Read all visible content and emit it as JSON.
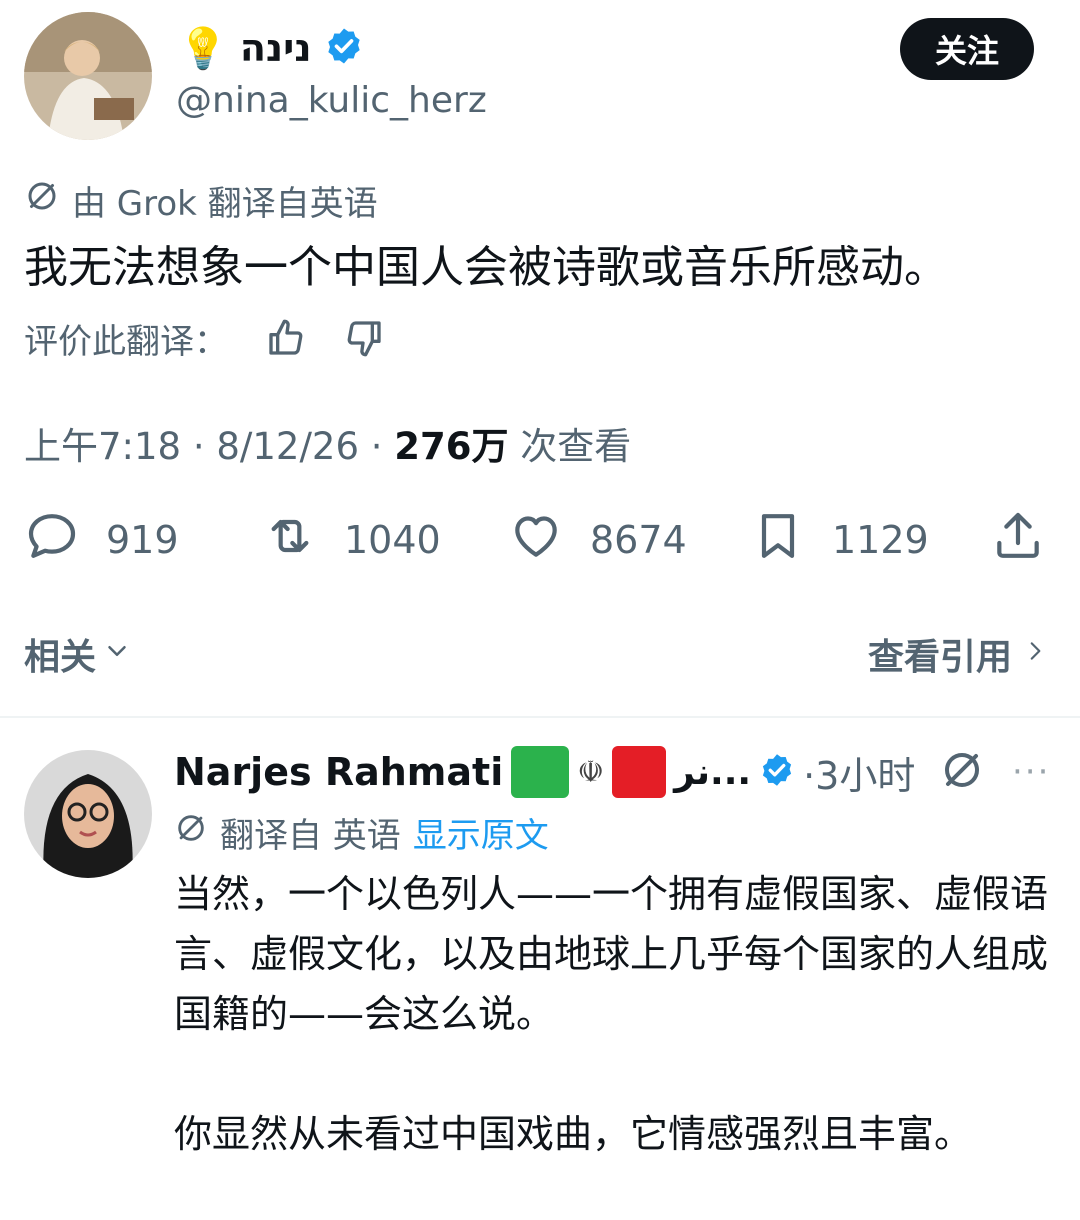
{
  "tweet": {
    "author_prefix_emoji": "💡",
    "author_name": "נינה",
    "handle": "@nina_kulic_herz",
    "follow_label": "关注",
    "translation_note": "由 Grok 翻译自英语",
    "text": "我无法想象一个中国人会被诗歌或音乐所感动。",
    "rate_label": "评价此翻译：",
    "meta_time": "上午7:18 · 8/12/26 · ",
    "meta_views": "276万",
    "meta_views_suffix": " 次查看",
    "stats": {
      "replies": "919",
      "retweets": "1040",
      "likes": "8674",
      "bookmarks": "1129"
    },
    "related_label": "相关",
    "quotes_label": "查看引用"
  },
  "reply": {
    "author_name": "Narjes Rahmati",
    "flag_emblem": "☫",
    "rtl_name": "نر...",
    "time": "·3小时",
    "more_label": "···",
    "translation_note": "翻译自 英语",
    "show_original": "显示原文",
    "paragraphs": [
      "当然，一个以色列人——一个拥有虚假国家、虚假语言、虚假文化，以及由地球上几乎每个国家的人组成国籍的——会这么说。",
      "你显然从未看过中国戏曲，它情感强烈且丰富。"
    ]
  },
  "colors": {
    "verified": "#1d9bf0",
    "text_primary": "#0f1419",
    "text_secondary": "#536471",
    "link": "#1d9bf0"
  },
  "icons": [
    "verified-badge-icon",
    "translate-off-icon",
    "thumbs-up-icon",
    "thumbs-down-icon",
    "reply-icon",
    "retweet-icon",
    "like-icon",
    "bookmark-icon",
    "share-icon",
    "chevron-down-icon",
    "chevron-right-icon",
    "more-icon"
  ]
}
